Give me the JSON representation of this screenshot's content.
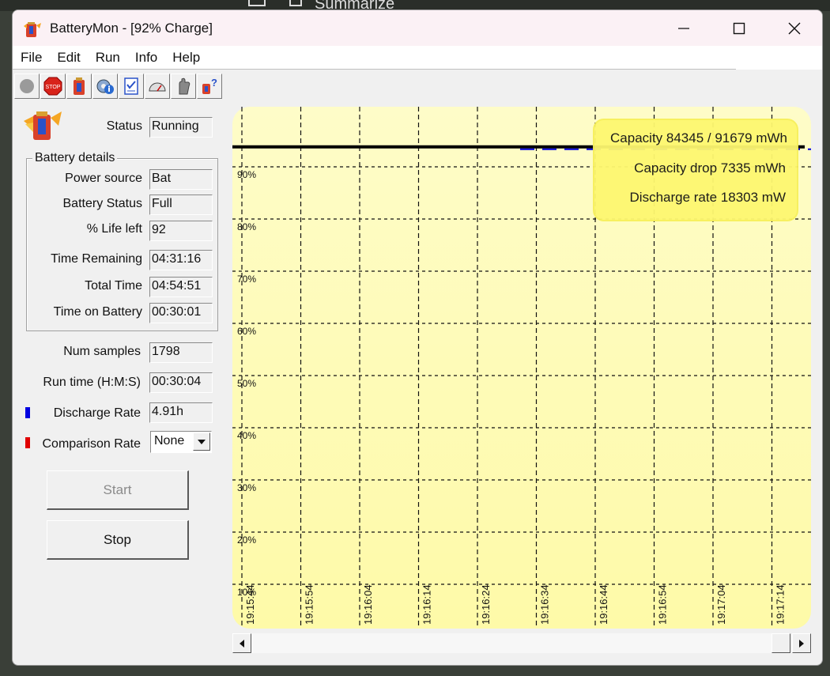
{
  "window": {
    "title": "BatteryMon - [92% Charge]"
  },
  "background": {
    "label": "Summarize"
  },
  "menu": [
    "File",
    "Edit",
    "Run",
    "Info",
    "Help"
  ],
  "toolbar": [
    {
      "name": "record-icon"
    },
    {
      "name": "stop-icon",
      "text": "STOP"
    },
    {
      "name": "battery-icon"
    },
    {
      "name": "gear-info-icon"
    },
    {
      "name": "checklist-icon"
    },
    {
      "name": "gauge-icon"
    },
    {
      "name": "hand-icon"
    },
    {
      "name": "help-icon"
    }
  ],
  "status": {
    "label": "Status",
    "value": "Running"
  },
  "battery": {
    "title": "Battery details",
    "power_source": {
      "label": "Power source",
      "value": "Bat"
    },
    "battery_status": {
      "label": "Battery Status",
      "value": "Full"
    },
    "life_left": {
      "label": "% Life left",
      "value": "92"
    },
    "time_remaining": {
      "label": "Time Remaining",
      "value": "04:31:16"
    },
    "total_time": {
      "label": "Total Time",
      "value": "04:54:51"
    },
    "time_on_battery": {
      "label": "Time on Battery",
      "value": "00:30:01"
    }
  },
  "num_samples": {
    "label": "Num samples",
    "value": "1798"
  },
  "run_time": {
    "label": "Run time (H:M:S)",
    "value": "00:30:04"
  },
  "discharge_rate": {
    "label": "Discharge Rate",
    "value": "4.91h",
    "color": "#0000e0"
  },
  "comparison_rate": {
    "label": "Comparison Rate",
    "value": "None",
    "color": "#e00000"
  },
  "buttons": {
    "start": "Start",
    "stop": "Stop"
  },
  "chart_info": {
    "capacity": "Capacity 84345 / 91679 mWh",
    "capacity_drop": "Capacity drop 7335 mWh",
    "discharge_rate": "Discharge rate 18303 mW"
  },
  "chart_data": {
    "type": "line",
    "y_ticks": [
      "90%",
      "80%",
      "70%",
      "60%",
      "50%",
      "40%",
      "30%",
      "20%",
      "10%"
    ],
    "x_ticks": [
      "19:15:44",
      "19:15:54",
      "19:16:04",
      "19:16:14",
      "19:16:24",
      "19:16:34",
      "19:16:44",
      "19:16:54",
      "19:17:04",
      "19:17:14"
    ],
    "ylim": [
      10,
      100
    ],
    "grid": true,
    "series": [
      {
        "color": "#000000",
        "style": "solid",
        "level": 92
      },
      {
        "color": "#0000e0",
        "style": "dashed",
        "level": 92
      }
    ]
  }
}
